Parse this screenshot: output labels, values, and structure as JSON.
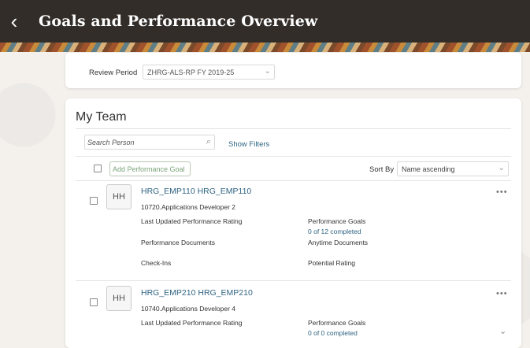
{
  "header": {
    "title": "Goals and Performance Overview",
    "back_icon": "chevron-left-icon"
  },
  "review": {
    "label": "Review Period",
    "value": "ZHRG-ALS-RP FY 2019-25"
  },
  "team": {
    "title": "My Team",
    "search_placeholder": "Search Person",
    "show_filters": "Show Filters",
    "add_goal": "Add Performance Goal",
    "sort_label": "Sort By",
    "sort_value": "Name ascending",
    "employees": [
      {
        "initials": "HH",
        "name": "HRG_EMP110 HRG_EMP110",
        "position": "10720.Applications Developer 2",
        "last_updated_label": "Last Updated Performance Rating",
        "goals_label": "Performance Goals",
        "goals_value": "0 of 12 completed",
        "docs_label": "Performance Documents",
        "anytime_label": "Anytime Documents",
        "checkins_label": "Check-Ins",
        "potential_label": "Potential Rating"
      },
      {
        "initials": "HH",
        "name": "HRG_EMP210 HRG_EMP210",
        "position": "10740.Applications Developer 4",
        "last_updated_label": "Last Updated Performance Rating",
        "goals_label": "Performance Goals",
        "goals_value": "0 of 0 completed"
      }
    ]
  },
  "icons": {
    "more": "more-icon",
    "search": "search-icon",
    "chevron_down": "chevron-down-icon"
  },
  "colors": {
    "header_bg": "#322d29",
    "link": "#2f6483",
    "add_goal_text": "#7aa47a"
  }
}
